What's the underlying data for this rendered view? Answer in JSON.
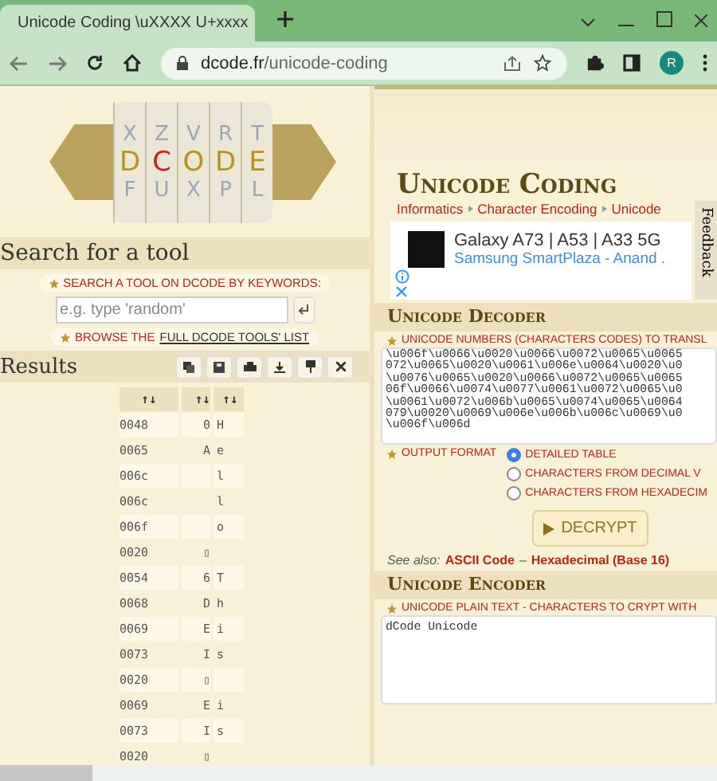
{
  "browser": {
    "tab_title": "Unicode Coding \\uXXXX U+xxxx",
    "url_domain": "dcode.fr",
    "url_path": "/unicode-coding",
    "avatar": "R"
  },
  "logo": {
    "top_letters": [
      "X",
      "Z",
      "V",
      "R",
      "T"
    ],
    "word": [
      "D",
      "C",
      "O",
      "D",
      "E"
    ],
    "bottom_letters": [
      "F",
      "U",
      "X",
      "P",
      "L"
    ]
  },
  "sidebar": {
    "search_heading": "Search for a tool",
    "search_label": "SEARCH A TOOL ON DCODE BY KEYWORDS:",
    "search_placeholder": "e.g. type 'random'",
    "browse_prefix": "BROWSE THE",
    "browse_link": "FULL DCODE TOOLS' LIST",
    "results_heading": "Results",
    "table": {
      "columns": [
        "↑↓",
        "↑↓",
        "↑↓"
      ],
      "rows": [
        [
          "0048",
          "0",
          "H"
        ],
        [
          "0065",
          "A",
          "e"
        ],
        [
          "006c",
          "",
          "l"
        ],
        [
          "006c",
          "",
          "l"
        ],
        [
          "006f",
          "",
          "o"
        ],
        [
          "0020",
          "▯",
          ""
        ],
        [
          "0054",
          "6",
          "T"
        ],
        [
          "0068",
          "D",
          "h"
        ],
        [
          "0069",
          "E",
          "i"
        ],
        [
          "0073",
          "I",
          "s"
        ],
        [
          "0020",
          "▯",
          ""
        ],
        [
          "0069",
          "E",
          "i"
        ],
        [
          "0073",
          "I",
          "s"
        ],
        [
          "0020",
          "▯",
          ""
        ]
      ]
    }
  },
  "main": {
    "title": "Unicode Coding",
    "breadcrumb": [
      "Informatics",
      "Character Encoding",
      "Unicode"
    ],
    "feedback": "Feedback",
    "ad": {
      "headline": "Galaxy A73 | A53 | A33 5G",
      "advertiser": "Samsung SmartPlaza - Anand ."
    },
    "decoder": {
      "heading": "Unicode Decoder",
      "input_label": "UNICODE NUMBERS (CHARACTERS CODES) TO TRANSL",
      "input_lines": [
        "\\u006f\\u0066\\u0020\\u0066\\u0072\\u0065\\u0065",
        "072\\u0065\\u0020\\u0061\\u006e\\u0064\\u0020\\u0",
        "\\u0076\\u0065\\u0020\\u0066\\u0072\\u0065\\u0065",
        "06f\\u0066\\u0074\\u0077\\u0061\\u0072\\u0065\\u0",
        "\\u0061\\u0072\\u006b\\u0065\\u0074\\u0065\\u0064",
        "079\\u0020\\u0069\\u006e\\u006b\\u006c\\u0069\\u0",
        "\\u006f\\u006d"
      ],
      "output_label": "OUTPUT FORMAT",
      "options": [
        {
          "label": "DETAILED TABLE",
          "selected": true
        },
        {
          "label": "CHARACTERS FROM DECIMAL V",
          "selected": false
        },
        {
          "label": "CHARACTERS FROM HEXADECIM",
          "selected": false
        }
      ],
      "button": "DECRYPT",
      "see_also_label": "See also:",
      "see_also_separator": "–",
      "see_also_links": [
        "ASCII Code",
        "Hexadecimal (Base 16)"
      ]
    },
    "encoder": {
      "heading": "Unicode Encoder",
      "input_label": "UNICODE PLAIN TEXT - CHARACTERS TO CRYPT WITH",
      "input_value": "dCode Unicode"
    }
  }
}
